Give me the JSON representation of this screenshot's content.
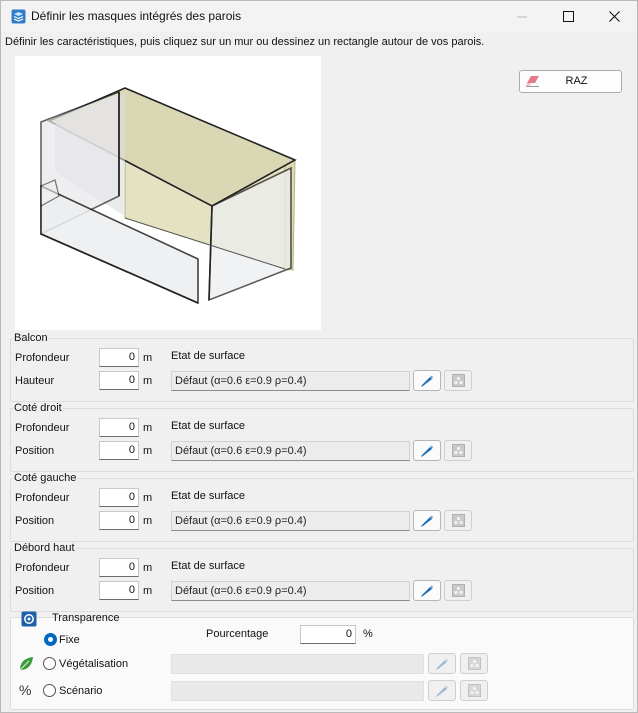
{
  "window": {
    "title": "Définir les masques intégrés des parois",
    "controls": [
      "minimize-icon",
      "maximize-icon",
      "close-icon"
    ]
  },
  "instruction": "Définir les caractéristiques, puis cliquez sur un mur ou dessinez un rectangle autour de vos parois.",
  "preview": {
    "image": "wall-masks-3d-preview",
    "highlight_color": "#e8e6c4"
  },
  "raz_label": "RAZ",
  "surface_state_label": "Etat de surface",
  "groups": [
    {
      "title": "Balcon",
      "fields": [
        {
          "label": "Profondeur",
          "value": "0",
          "unit": "m"
        },
        {
          "label": "Hauteur",
          "value": "0",
          "unit": "m"
        }
      ],
      "surface_value": "Défaut (α=0.6 ε=0.9 ρ=0.4)"
    },
    {
      "title": "Coté droit",
      "fields": [
        {
          "label": "Profondeur",
          "value": "0",
          "unit": "m"
        },
        {
          "label": "Position",
          "value": "0",
          "unit": "m"
        }
      ],
      "surface_value": "Défaut (α=0.6 ε=0.9 ρ=0.4)"
    },
    {
      "title": "Coté gauche",
      "fields": [
        {
          "label": "Profondeur",
          "value": "0",
          "unit": "m"
        },
        {
          "label": "Position",
          "value": "0",
          "unit": "m"
        }
      ],
      "surface_value": "Défaut (α=0.6 ε=0.9 ρ=0.4)"
    },
    {
      "title": "Débord haut",
      "fields": [
        {
          "label": "Profondeur",
          "value": "0",
          "unit": "m"
        },
        {
          "label": "Position",
          "value": "0",
          "unit": "m"
        }
      ],
      "surface_value": "Défaut (α=0.6 ε=0.9 ρ=0.4)"
    }
  ],
  "transparency": {
    "title": "Transparence",
    "options": [
      {
        "label": "Fixe",
        "selected": true
      },
      {
        "label": "Végétalisation",
        "selected": false
      },
      {
        "label": "Scénario",
        "selected": false
      }
    ],
    "percentage_label": "Pourcentage",
    "percentage_value": "0",
    "percentage_unit": "%",
    "percent_symbol": "%"
  },
  "colors": {
    "accent": "#0067c0",
    "leaf": "#3a9a3a",
    "pencil": "#1f6fb5"
  }
}
